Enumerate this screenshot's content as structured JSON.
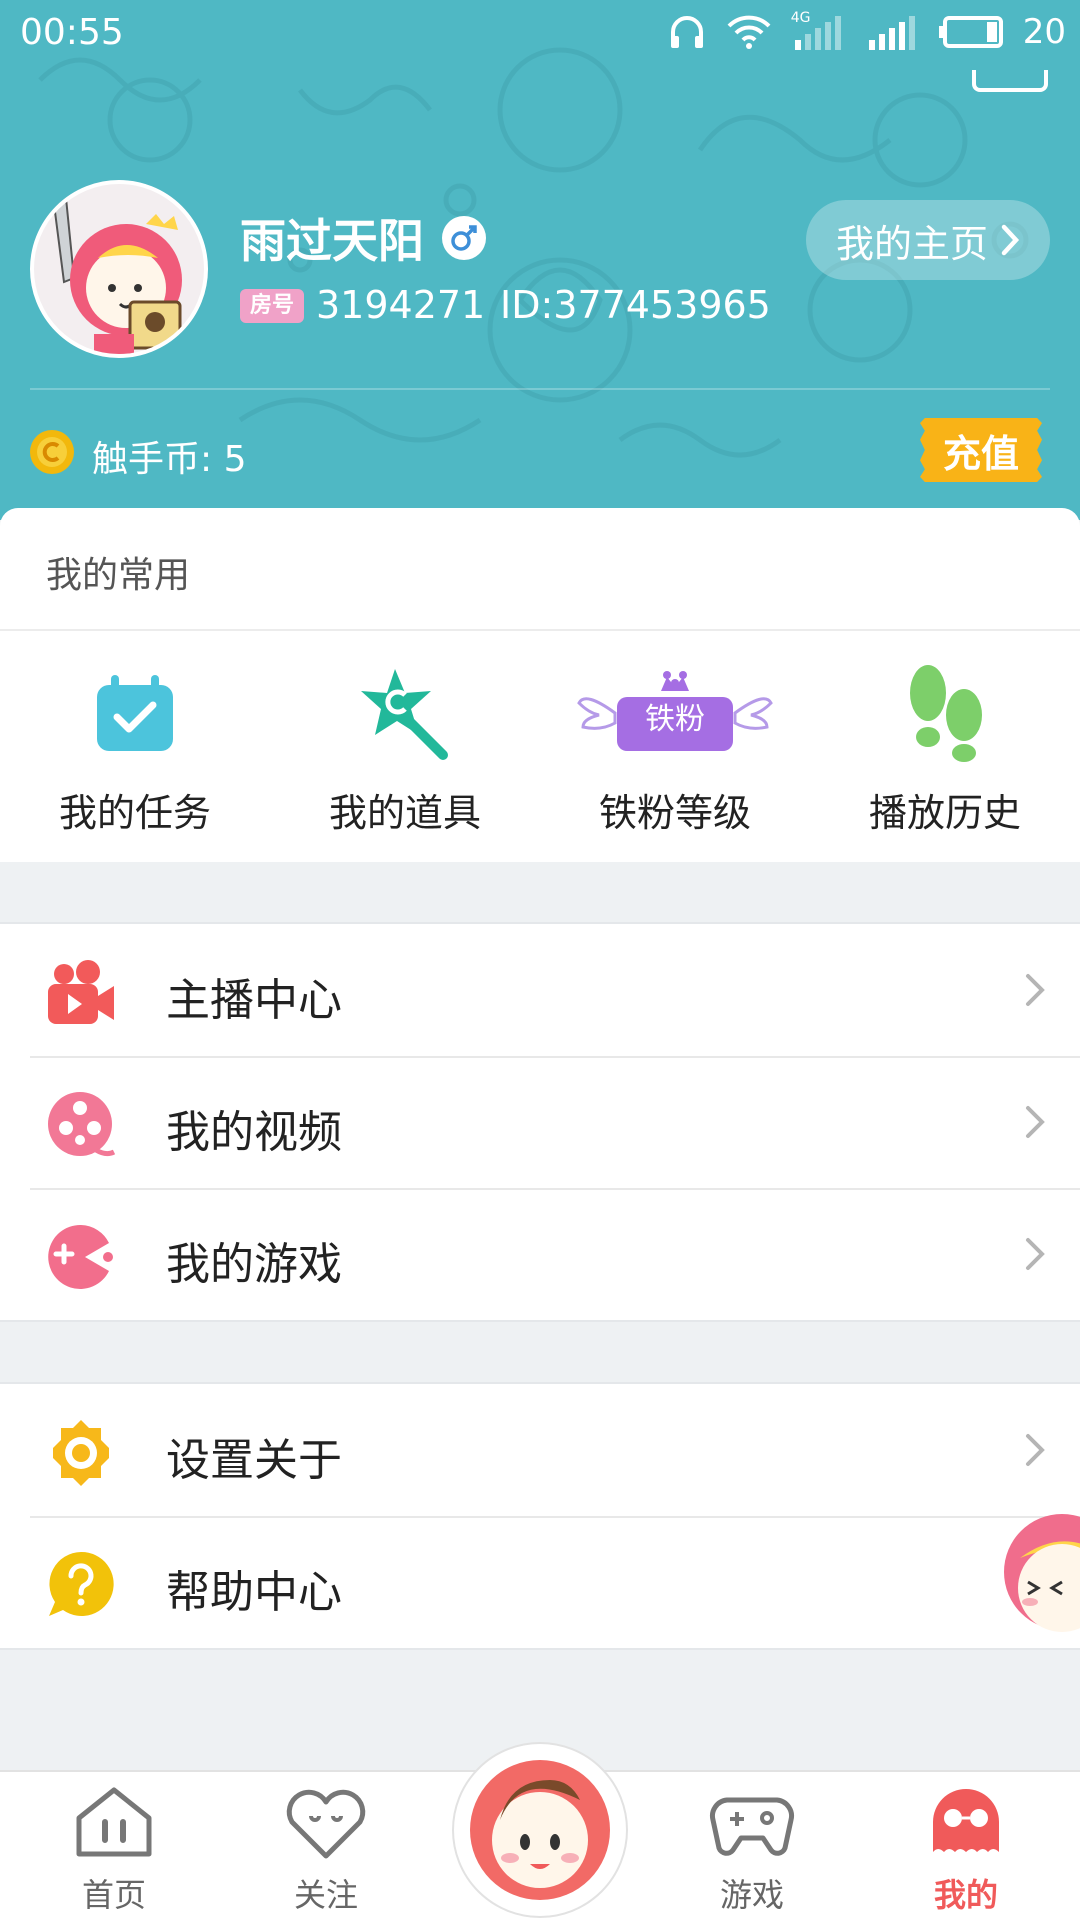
{
  "status_bar": {
    "time": "00:55",
    "network": "4G",
    "battery": "20"
  },
  "profile": {
    "username": "雨过天阳",
    "gender_symbol": "♂",
    "room_badge": "房号",
    "room_number": "3194271",
    "user_id": "ID:377453965",
    "homepage_button": "我的主页",
    "coins_label": "触手币: 5",
    "recharge_button": "充值"
  },
  "common": {
    "title": "我的常用",
    "items": [
      {
        "label": "我的任务",
        "icon": "task-calendar-icon"
      },
      {
        "label": "我的道具",
        "icon": "magic-wand-icon"
      },
      {
        "label": "铁粉等级",
        "icon": "fan-level-icon",
        "badge": "铁粉"
      },
      {
        "label": "播放历史",
        "icon": "footprints-icon"
      }
    ]
  },
  "menu_group1": [
    {
      "label": "主播中心",
      "icon": "video-camera-icon"
    },
    {
      "label": "我的视频",
      "icon": "film-reel-icon"
    },
    {
      "label": "我的游戏",
      "icon": "game-pacman-icon"
    }
  ],
  "menu_group2": [
    {
      "label": "设置关于",
      "icon": "settings-gear-icon"
    },
    {
      "label": "帮助中心",
      "icon": "help-question-icon"
    }
  ],
  "bottom_nav": [
    {
      "label": "首页",
      "icon": "home-icon"
    },
    {
      "label": "关注",
      "icon": "heart-face-icon"
    },
    {
      "label": "游戏",
      "icon": "gamepad-icon"
    },
    {
      "label": "我的",
      "icon": "octopus-icon"
    }
  ],
  "colors": {
    "header": "#4fb8c4",
    "accent": "#f05a5a",
    "recharge": "#f9b317",
    "task": "#4cc4dc",
    "wand": "#22b89a",
    "fan": "#a56ee3",
    "footprints": "#7dcf6a",
    "camera": "#f25a5a",
    "film": "#f27896",
    "game": "#f26e8c",
    "settings": "#f7b81a",
    "help": "#f2c20a"
  }
}
